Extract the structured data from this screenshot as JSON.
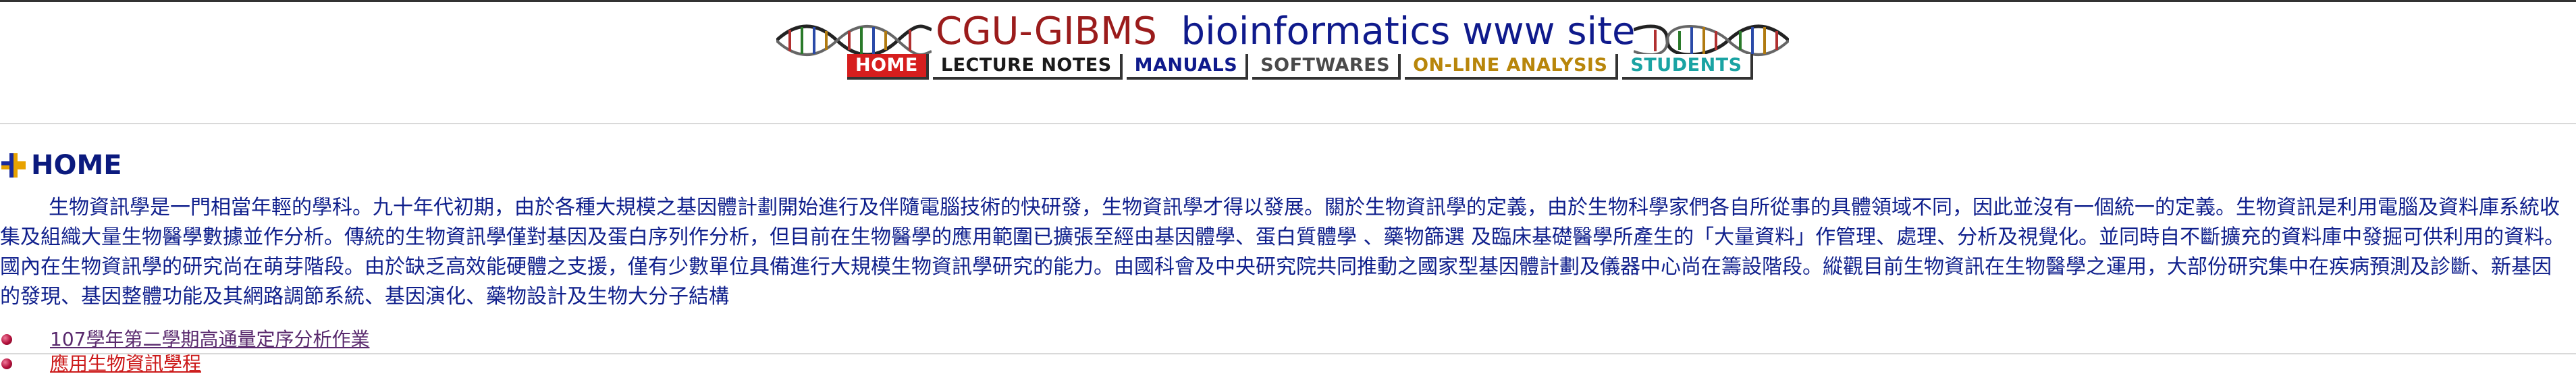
{
  "header": {
    "title_part1": "CGU-GIBMS",
    "title_part2": "bioinformatics www site",
    "title_color1": "#9b1c1c",
    "title_color2": "#0f1a8c",
    "left_decoration_icon": "dna-helix-icon",
    "right_decoration_icon": "dna-helix-icon"
  },
  "nav": {
    "items": [
      {
        "label": "HOME",
        "color": "#ffffff",
        "bg": "#d61e1e"
      },
      {
        "label": "LECTURE NOTES",
        "color": "#1a1a1a",
        "bg": "#ffffff"
      },
      {
        "label": "MANUALS",
        "color": "#0f1a8c",
        "bg": "#ffffff"
      },
      {
        "label": "SOFTWARES",
        "color": "#4a4a4a",
        "bg": "#ffffff"
      },
      {
        "label": "ON-LINE ANALYSIS",
        "color": "#b8860b",
        "bg": "#ffffff"
      },
      {
        "label": "STUDENTS",
        "color": "#1aa3a3",
        "bg": "#ffffff"
      }
    ]
  },
  "home": {
    "icon": "plus-cross-icon",
    "title": "HOME",
    "intro": "生物資訊學是一門相當年輕的學科。九十年代初期，由於各種大規模之基因體計劃開始進行及伴隨電腦技術的快研發，生物資訊學才得以發展。關於生物資訊學的定義，由於生物科學家們各自所從事的具體領域不同，因此並沒有一個統一的定義。生物資訊是利用電腦及資料庫系統收集及組織大量生物醫學數據並作分析。傳統的生物資訊學僅對基因及蛋白序列作分析，但目前在生物醫學的應用範圍已擴張至經由基因體學、蛋白質體學 、藥物篩選 及臨床基礎醫學所產生的「大量資料」作管理、處理、分析及視覺化。並同時自不斷擴充的資料庫中發掘可供利用的資料。國內在生物資訊學的研究尚在萌芽階段。由於缺乏高效能硬體之支援，僅有少數單位具備進行大規模生物資訊學研究的能力。由國科會及中央研究院共同推動之國家型基因體計劃及儀器中心尚在籌設階段。縱觀目前生物資訊在生物醫學之運用，大部份研究集中在疾病預測及診斷、新基因的發現、基因整體功能及其網路調節系統、基因演化、藥物設計及生物大分子結構"
  },
  "links": [
    {
      "label": "107學年第二學期高通量定序分析作業",
      "color": "#5a2a6e"
    },
    {
      "label": "應用生物資訊學程",
      "color": "#cc1a1a"
    }
  ]
}
